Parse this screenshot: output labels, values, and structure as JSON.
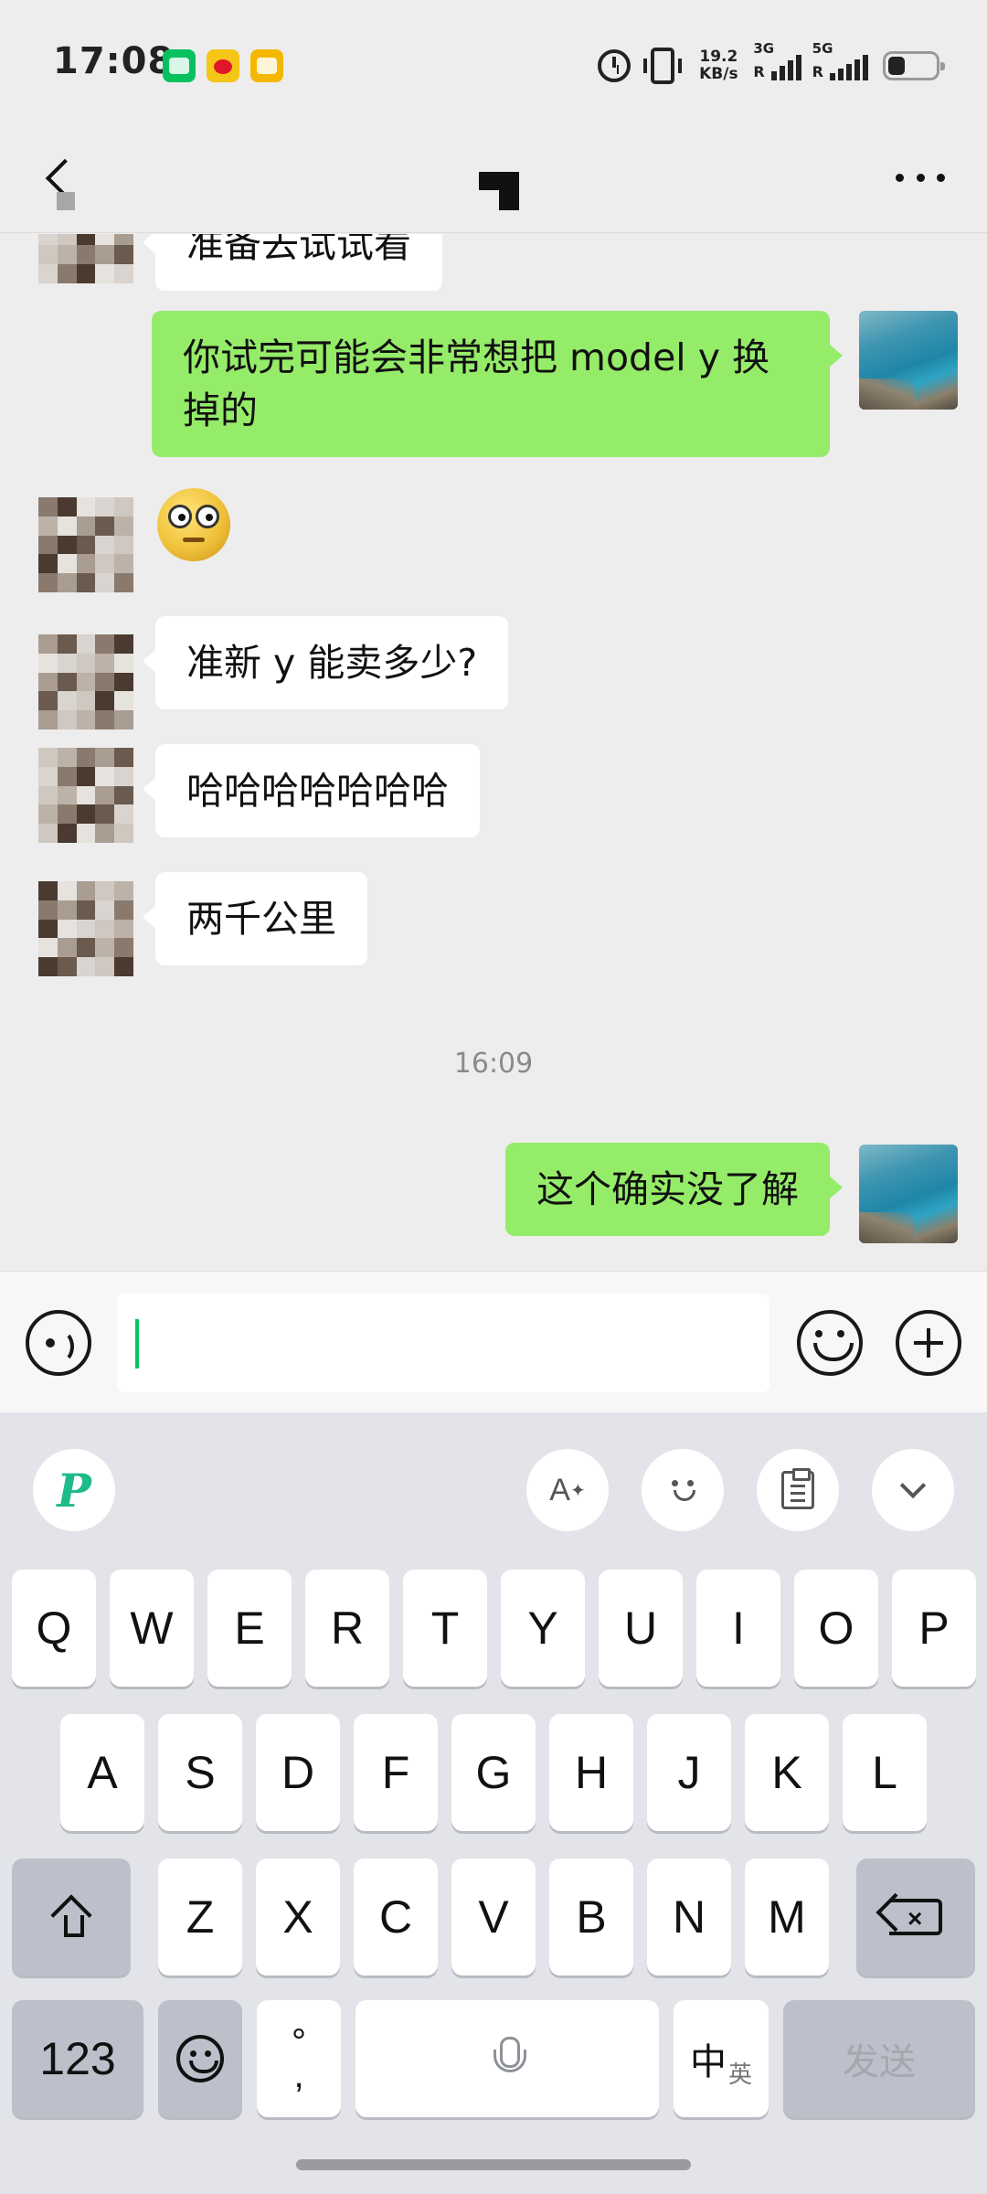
{
  "status_bar": {
    "time": "17:08",
    "net_speed_value": "19.2",
    "net_speed_unit": "KB/s",
    "sim1_label": "3G",
    "sim1_r": "R",
    "sim2_label": "5G",
    "sim2_r": "R",
    "battery_percent": 35
  },
  "nav": {
    "title": ""
  },
  "messages": [
    {
      "side": "in",
      "text": "准备去试试看"
    },
    {
      "side": "out",
      "text": "你试完可能会非常想把 model y 换掉的"
    },
    {
      "side": "in",
      "type": "sticker",
      "icon": "dizzy-face-sticker"
    },
    {
      "side": "in",
      "text": "准新 y 能卖多少?"
    },
    {
      "side": "in",
      "text": "哈哈哈哈哈哈哈"
    },
    {
      "side": "in",
      "text": "两千公里"
    },
    {
      "type": "timestamp",
      "text": "16:09"
    },
    {
      "side": "out",
      "text": "这个确实没了解"
    }
  ],
  "input": {
    "value": "",
    "placeholder": ""
  },
  "keyboard": {
    "row1": [
      "Q",
      "W",
      "E",
      "R",
      "T",
      "Y",
      "U",
      "I",
      "O",
      "P"
    ],
    "row2": [
      "A",
      "S",
      "D",
      "F",
      "G",
      "H",
      "J",
      "K",
      "L"
    ],
    "row3": [
      "Z",
      "X",
      "C",
      "V",
      "B",
      "N",
      "M"
    ],
    "numbers_key": "123",
    "punct_top": "°",
    "punct_bottom": ",",
    "lang_main": "中",
    "lang_sub": "英",
    "send_key": "发送",
    "ai_key": "A",
    "brand_key": "P"
  },
  "colors": {
    "background": "#ededed",
    "outgoing_bubble": "#95ec69",
    "incoming_bubble": "#ffffff",
    "caret": "#07c160",
    "keyboard_bg": "#e3e4e9",
    "brand_green": "#1dbb8a"
  }
}
